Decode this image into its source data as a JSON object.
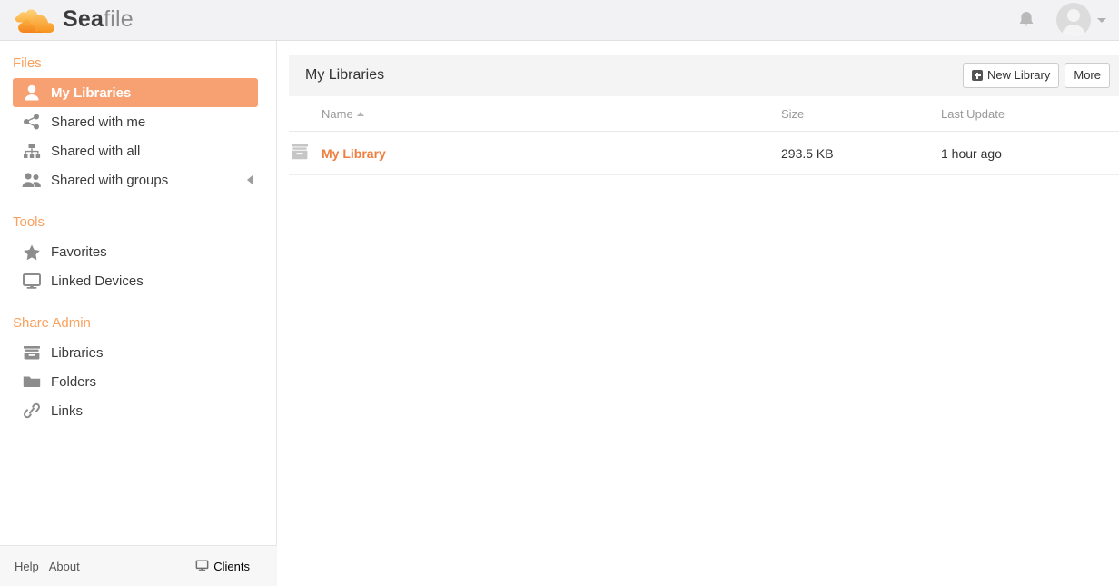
{
  "header": {
    "brand_sea": "Sea",
    "brand_file": "file",
    "notifications_icon": "bell-icon",
    "avatar_icon": "avatar-icon",
    "user_menu_caret": "chevron-down-icon"
  },
  "sidebar": {
    "sections": [
      {
        "title": "Files",
        "items": [
          {
            "label": "My Libraries",
            "icon": "person-icon",
            "active": true
          },
          {
            "label": "Shared with me",
            "icon": "share-nodes-icon",
            "active": false
          },
          {
            "label": "Shared with all",
            "icon": "sitemap-icon",
            "active": false
          },
          {
            "label": "Shared with groups",
            "icon": "people-icon",
            "active": false,
            "collapse": "collapse-left-icon"
          }
        ]
      },
      {
        "title": "Tools",
        "items": [
          {
            "label": "Favorites",
            "icon": "star-icon",
            "active": false
          },
          {
            "label": "Linked Devices",
            "icon": "monitor-icon",
            "active": false
          }
        ]
      },
      {
        "title": "Share Admin",
        "items": [
          {
            "label": "Libraries",
            "icon": "library-box-icon",
            "active": false
          },
          {
            "label": "Folders",
            "icon": "folder-icon",
            "active": false
          },
          {
            "label": "Links",
            "icon": "link-icon",
            "active": false
          }
        ]
      }
    ],
    "footer": {
      "help": "Help",
      "about": "About",
      "clients": "Clients",
      "clients_icon": "monitor-icon"
    }
  },
  "main": {
    "panel_title": "My Libraries",
    "new_library_label": "New Library",
    "new_library_icon": "plus-square-icon",
    "more_label": "More",
    "table": {
      "columns": [
        "Name",
        "Size",
        "Last Update"
      ],
      "sort_column": "Name",
      "sort_direction": "asc",
      "rows": [
        {
          "icon": "library-box-icon",
          "name": "My Library",
          "size": "293.5 KB",
          "last_update": "1 hour ago"
        }
      ]
    }
  },
  "colors": {
    "accent_orange": "#ef7f3f",
    "section_heading": "#f9a15e",
    "active_item_bg": "#f7a072",
    "header_bg": "#f2f2f4",
    "panel_header_bg": "#f4f4f4"
  }
}
